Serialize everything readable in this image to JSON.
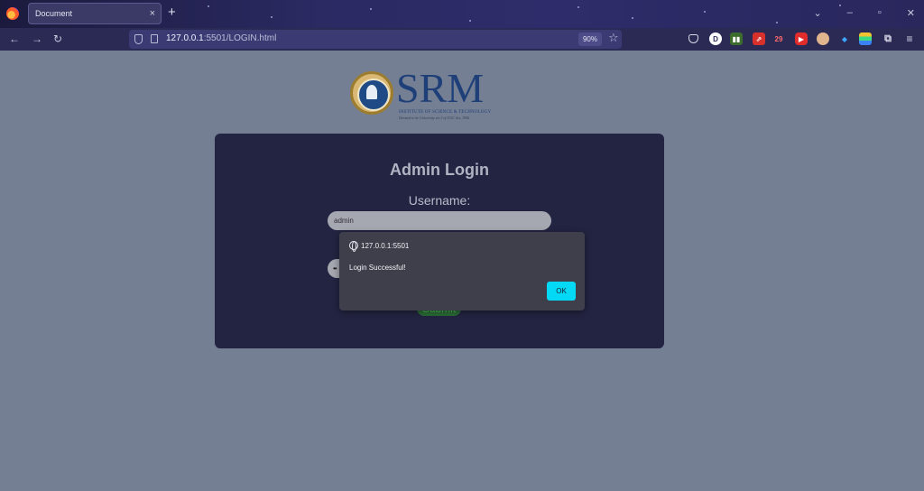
{
  "browser": {
    "tab_title": "Document",
    "tab_close": "×",
    "new_tab": "+",
    "url_host": "127.0.0.1",
    "url_rest": ":5501/LOGIN.html",
    "zoom": "90%",
    "extension_count": "29",
    "extension_d": "D",
    "icons": [
      "back-icon",
      "forward-icon",
      "reload-icon",
      "shield-icon",
      "page-icon",
      "star-icon",
      "pocket-icon",
      "extensions-icon",
      "menu-icon"
    ]
  },
  "logo": {
    "text": "SRM",
    "subtitle": "INSTITUTE OF SCIENCE & TECHNOLOGY",
    "tagline": "Deemed to be University u/s 3 of UGC Act, 1956"
  },
  "login": {
    "title": "Admin Login",
    "username_label": "Username:",
    "username_value": "admin",
    "password_value": "••",
    "submit_label": "Submit"
  },
  "dialog": {
    "origin": "127.0.0.1:5501",
    "message": "Login Successful!",
    "ok_label": "OK"
  },
  "colors": {
    "page_bg": "#747f93",
    "card_bg": "#232442",
    "ok_button": "#03d8f4",
    "submit_text": "#4dbd5d"
  }
}
